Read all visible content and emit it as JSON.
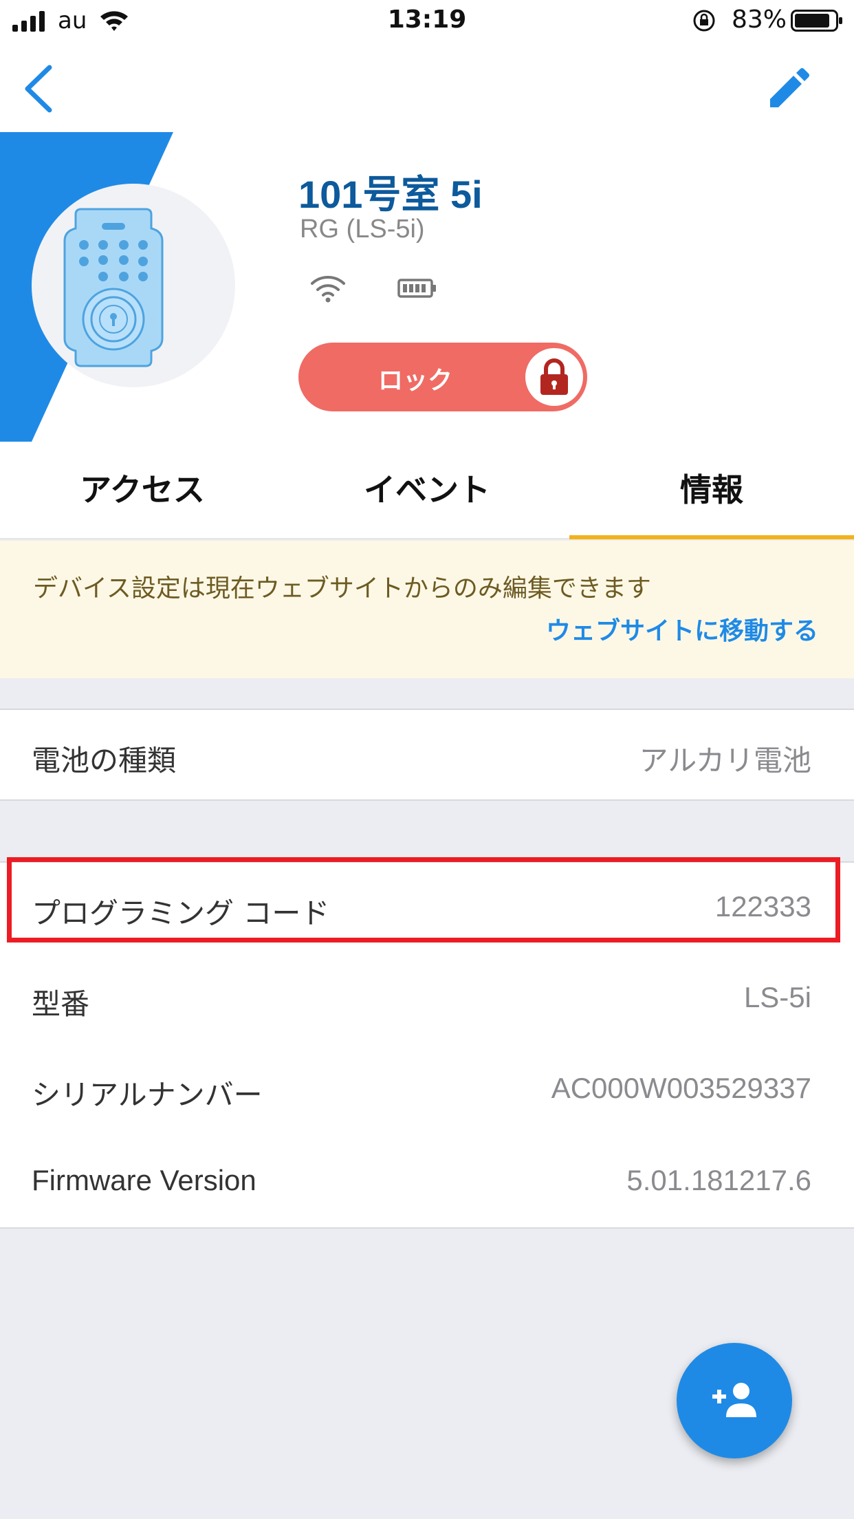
{
  "status_bar": {
    "carrier": "au",
    "time": "13:19",
    "battery_percent": "83%"
  },
  "device": {
    "name": "101号室 5i",
    "model": "RG (LS-5i)",
    "lock_label": "ロック",
    "lock_state": "locked"
  },
  "tabs": [
    {
      "label": "アクセス",
      "selected": false
    },
    {
      "label": "イベント",
      "selected": false
    },
    {
      "label": "情報",
      "selected": true
    }
  ],
  "banner": {
    "message": "デバイス設定は現在ウェブサイトからのみ編集できます",
    "link": "ウェブサイトに移動する"
  },
  "info": {
    "battery_type": {
      "label": "電池の種類",
      "value": "アルカリ電池"
    },
    "programming_code": {
      "label": "プログラミング コード",
      "value": "122333"
    },
    "model_number": {
      "label": "型番",
      "value": "LS-5i"
    },
    "serial_number": {
      "label": "シリアルナンバー",
      "value": "AC000W003529337"
    },
    "firmware_version": {
      "label": "Firmware Version",
      "value": "5.01.181217.6"
    }
  },
  "colors": {
    "accent": "#1f8ae6",
    "title": "#0d5a9c",
    "lock_button": "#ef6b64",
    "tab_indicator": "#f2b21a",
    "highlight_box": "#ec1c24",
    "banner_bg": "#fdf8e6"
  },
  "icons": [
    "signal-icon",
    "wifi-icon",
    "rotation-lock-icon",
    "battery-icon",
    "back-chevron-icon",
    "pencil-icon",
    "padlock-icon",
    "add-user-icon"
  ]
}
